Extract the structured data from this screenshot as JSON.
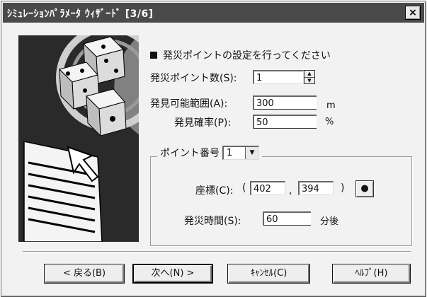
{
  "window": {
    "title": "ｼﾐｭﾚｰｼｮﾝﾊﾟﾗﾒｰﾀ ｳｨｻﾞｰﾄﾞ [3/6]",
    "close_glyph": "×"
  },
  "heading": "発災ポイントの設定を行ってください",
  "fields": {
    "count_label": "発災ポイント数(S):",
    "count_value": "1",
    "range_label": "発見可能範囲(A):",
    "range_value": "300",
    "range_unit": "m",
    "prob_label": "発見確率(P):",
    "prob_value": "50",
    "prob_unit": "%"
  },
  "group": {
    "label": "ポイント番号",
    "point_value": "1",
    "coord_label": "座標(C):",
    "coord_open": "(",
    "coord_x": "402",
    "coord_sep": ",",
    "coord_y": "394",
    "coord_close": ")",
    "pick_glyph": "●",
    "time_label": "発災時間(S):",
    "time_value": "60",
    "time_unit": "分後"
  },
  "buttons": {
    "back": "< 戻る(B)",
    "next": "次へ(N) >",
    "cancel": "ｷｬﾝｾﾙ(C)",
    "help": "ﾍﾙﾌﾟ(H)"
  },
  "icons": {
    "spin_up": "▲",
    "spin_down": "▼",
    "dropdown": "▼"
  }
}
